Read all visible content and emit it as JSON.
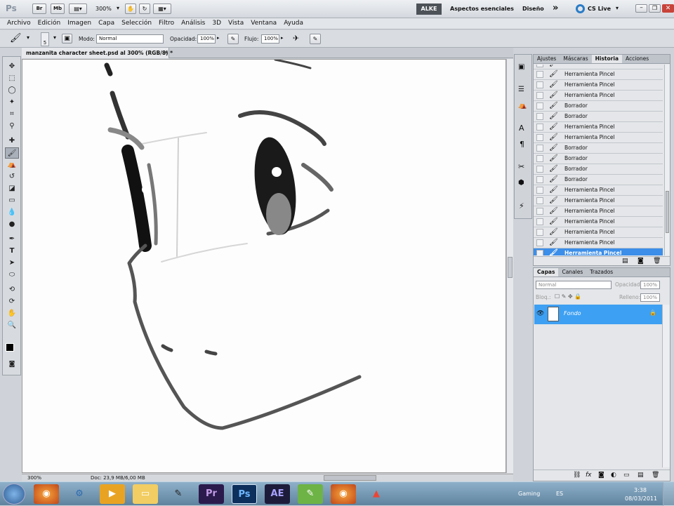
{
  "appbar": {
    "logo": "Ps",
    "bridge": "Br",
    "minibridge": "Mb",
    "zoom": "300%",
    "workspace_user": "ALKE",
    "workspace_essentials": "Aspectos esenciales",
    "workspace_design": "Diseño",
    "more": "»",
    "cslive": "CS Live"
  },
  "menu": [
    "Archivo",
    "Edición",
    "Imagen",
    "Capa",
    "Selección",
    "Filtro",
    "Análisis",
    "3D",
    "Vista",
    "Ventana",
    "Ayuda"
  ],
  "options": {
    "brush_size": "5",
    "mode_label": "Modo:",
    "mode_value": "Normal",
    "opacity_label": "Opacidad:",
    "opacity_value": "100%",
    "flow_label": "Flujo:",
    "flow_value": "100%"
  },
  "document": {
    "tab_title": "manzanita character sheet.psd al 300% (RGB/8) *",
    "zoom": "300%",
    "doc_info": "Doc: 23,9 MB/6,00 MB"
  },
  "history_panel": {
    "tabs": [
      "Ajustes",
      "Máscaras",
      "Historia",
      "Acciones"
    ],
    "active_tab": "Historia",
    "items": [
      "Herramienta Pincel",
      "Herramienta Pincel",
      "Herramienta Pincel",
      "Borrador",
      "Borrador",
      "Herramienta Pincel",
      "Herramienta Pincel",
      "Borrador",
      "Borrador",
      "Borrador",
      "Borrador",
      "Herramienta Pincel",
      "Herramienta Pincel",
      "Herramienta Pincel",
      "Herramienta Pincel",
      "Herramienta Pincel",
      "Herramienta Pincel",
      "Herramienta Pincel"
    ]
  },
  "layers_panel": {
    "tabs": [
      "Capas",
      "Canales",
      "Trazados"
    ],
    "blend_mode": "Normal",
    "opacity_label": "Opacidad:",
    "opacity_value": "100%",
    "lock_label": "Bloq.:",
    "fill_label": "Relleno:",
    "fill_value": "100%",
    "layer_name": "Fondo"
  },
  "taskbar": {
    "gaming": "Gaming",
    "lang": "ES",
    "time": "3:38",
    "date": "08/03/2011",
    "apps": [
      "firefox",
      "utilities",
      "media-player",
      "folder",
      "brush",
      "premiere",
      "photoshop",
      "after-effects",
      "notebook",
      "firefox",
      "acrobat"
    ]
  },
  "colors": {
    "selection_blue": "#3c8ee8",
    "layer_blue": "#3ea0f2",
    "taskbar": "#6f93b0"
  }
}
